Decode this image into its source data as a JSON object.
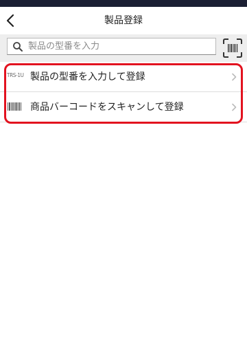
{
  "header": {
    "title": "製品登録",
    "back_icon": "chevron-left-icon"
  },
  "search": {
    "placeholder": "製品の型番を入力",
    "value": "",
    "search_icon": "search-icon",
    "scan_icon": "barcode-scan-icon"
  },
  "menu": {
    "items": [
      {
        "icon_text": "TRS-1U",
        "icon": "model-number-icon",
        "label": "製品の型番を入力して登録"
      },
      {
        "icon": "barcode-icon",
        "label": "商品バーコードをスキャンして登録"
      }
    ]
  },
  "colors": {
    "status_bar": "#1b1f33",
    "search_bar_bg": "#eeeeee",
    "highlight": "#e2121f",
    "chevron": "#bbbbbb"
  }
}
